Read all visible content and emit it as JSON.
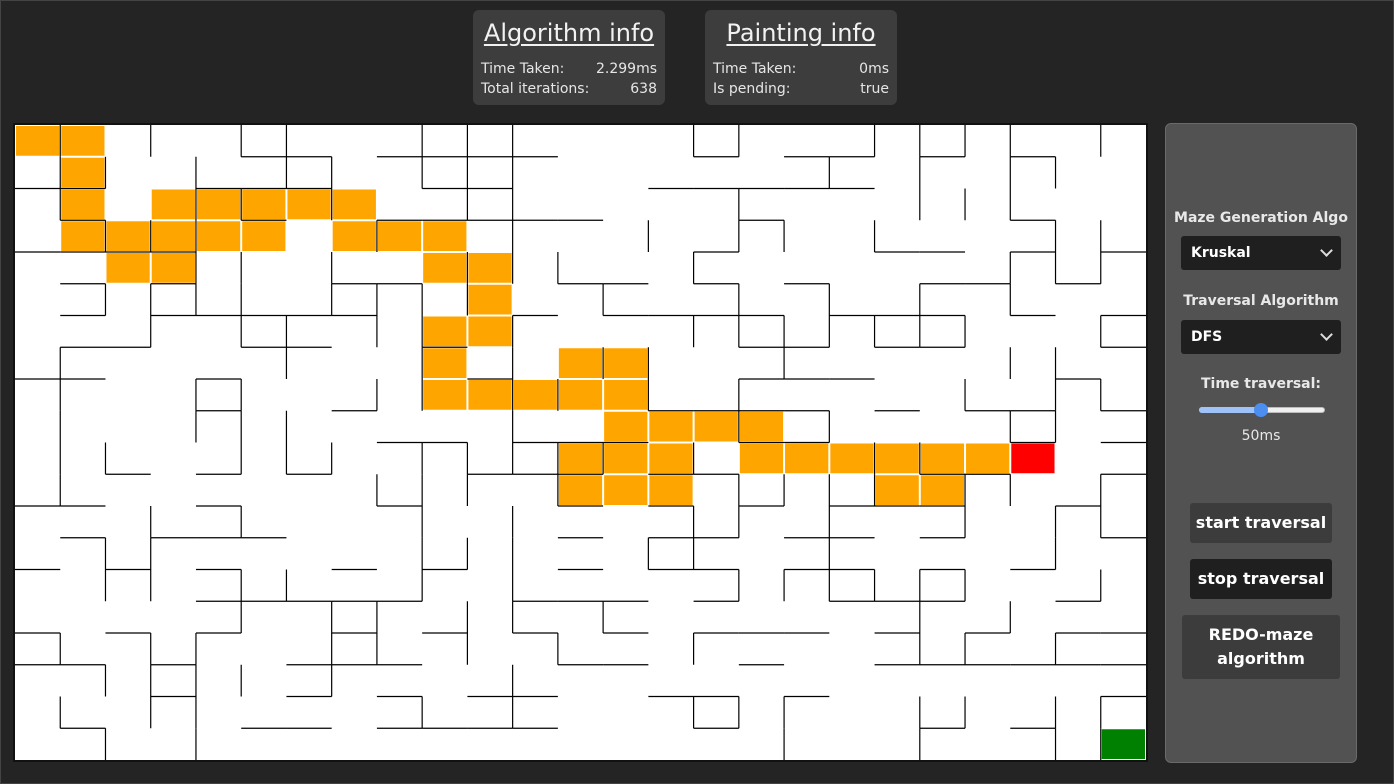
{
  "algorithm_info": {
    "title": "Algorithm info",
    "time_label": "Time Taken:",
    "time_value": "2.299ms",
    "iterations_label": "Total iterations:",
    "iterations_value": "638"
  },
  "painting_info": {
    "title": "Painting info",
    "time_label": "Time Taken:",
    "time_value": "0ms",
    "pending_label": "Is pending:",
    "pending_value": "true"
  },
  "controls": {
    "maze_algo_label": "Maze Generation Algo",
    "maze_algo_selected": "Kruskal",
    "traversal_label": "Traversal Algorithm",
    "traversal_selected": "DFS",
    "time_label": "Time traversal:",
    "time_value": "50ms",
    "slider_fraction": 0.49,
    "start_button": "start traversal",
    "stop_button": "stop traversal",
    "redo_button": "REDO-maze algorithm"
  },
  "colors": {
    "visited": "#ffa500",
    "current": "#ff0000",
    "goal": "#008000",
    "wall": "#000000",
    "maze_bg": "#ffffff",
    "panel_bg": "#525252"
  },
  "maze": {
    "cols": 25,
    "rows": 20,
    "visited_cells": [
      [
        0,
        0
      ],
      [
        1,
        0
      ],
      [
        1,
        1
      ],
      [
        1,
        2
      ],
      [
        3,
        2
      ],
      [
        4,
        2
      ],
      [
        5,
        2
      ],
      [
        6,
        2
      ],
      [
        7,
        2
      ],
      [
        1,
        3
      ],
      [
        2,
        3
      ],
      [
        3,
        3
      ],
      [
        4,
        3
      ],
      [
        5,
        3
      ],
      [
        7,
        3
      ],
      [
        8,
        3
      ],
      [
        9,
        3
      ],
      [
        2,
        4
      ],
      [
        3,
        4
      ],
      [
        9,
        4
      ],
      [
        10,
        4
      ],
      [
        10,
        5
      ],
      [
        9,
        6
      ],
      [
        10,
        6
      ],
      [
        9,
        7
      ],
      [
        12,
        7
      ],
      [
        13,
        7
      ],
      [
        9,
        8
      ],
      [
        10,
        8
      ],
      [
        11,
        8
      ],
      [
        12,
        8
      ],
      [
        13,
        8
      ],
      [
        13,
        9
      ],
      [
        14,
        9
      ],
      [
        15,
        9
      ],
      [
        16,
        9
      ],
      [
        12,
        10
      ],
      [
        13,
        10
      ],
      [
        14,
        10
      ],
      [
        16,
        10
      ],
      [
        17,
        10
      ],
      [
        18,
        10
      ],
      [
        19,
        10
      ],
      [
        20,
        10
      ],
      [
        21,
        10
      ],
      [
        12,
        11
      ],
      [
        13,
        11
      ],
      [
        14,
        11
      ],
      [
        19,
        11
      ],
      [
        20,
        11
      ]
    ],
    "current_cell": [
      22,
      10
    ],
    "goal_cell": [
      24,
      19
    ]
  }
}
